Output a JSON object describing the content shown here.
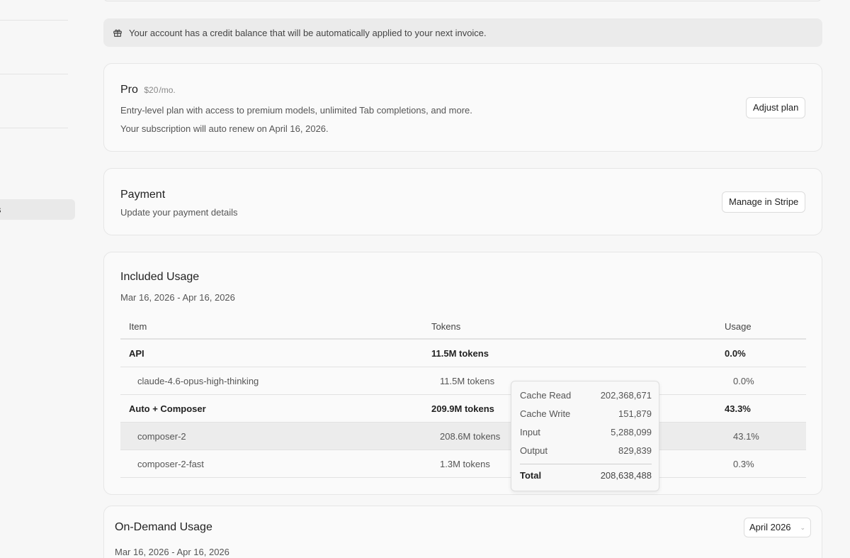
{
  "sidebar": {
    "active_item_fragment": "s"
  },
  "notice": {
    "icon": "gift-icon",
    "text": "Your account has a credit balance that will be automatically applied to your next invoice."
  },
  "plan": {
    "name": "Pro",
    "price": "$20",
    "period": "/mo.",
    "description": "Entry-level plan with access to premium models, unlimited Tab completions, and more.",
    "renewal": "Your subscription will auto renew on April 16, 2026.",
    "button": "Adjust plan"
  },
  "payment": {
    "title": "Payment",
    "subtitle": "Update your payment details",
    "button": "Manage in Stripe"
  },
  "included_usage": {
    "title": "Included Usage",
    "period": "Mar 16, 2026 - Apr 16, 2026",
    "columns": {
      "item": "Item",
      "tokens": "Tokens",
      "usage": "Usage"
    },
    "rows": [
      {
        "item": "API",
        "tokens": "11.5M tokens",
        "usage": "0.0%"
      },
      {
        "item": "claude-4.6-opus-high-thinking",
        "tokens": "11.5M tokens",
        "usage": "0.0%"
      },
      {
        "item": "Auto + Composer",
        "tokens": "209.9M tokens",
        "usage": "43.3%"
      },
      {
        "item": "composer-2",
        "tokens": "208.6M tokens",
        "usage": "43.1%"
      },
      {
        "item": "composer-2-fast",
        "tokens": "1.3M tokens",
        "usage": "0.3%"
      }
    ],
    "tooltip": {
      "cache_read_label": "Cache Read",
      "cache_read": "202,368,671",
      "cache_write_label": "Cache Write",
      "cache_write": "151,879",
      "input_label": "Input",
      "input": "5,288,099",
      "output_label": "Output",
      "output": "829,839",
      "total_label": "Total",
      "total": "208,638,488"
    }
  },
  "on_demand": {
    "title": "On-Demand Usage",
    "period": "Mar 16, 2026 - Apr 16, 2026",
    "month_select": "April 2026"
  }
}
